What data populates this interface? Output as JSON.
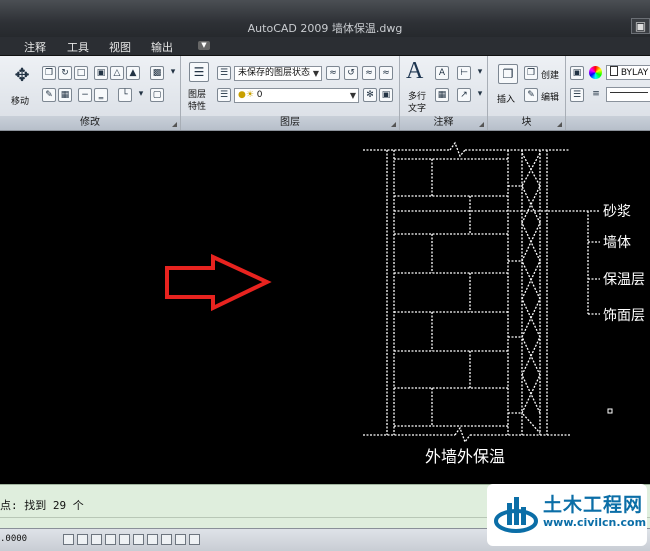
{
  "window": {
    "title": "AutoCAD 2009  墙体保温.dwg"
  },
  "tabs": [
    "注释",
    "工具",
    "视图",
    "输出"
  ],
  "ribbon": {
    "modify": {
      "move_label": "移动",
      "panel_label": "修改"
    },
    "layers": {
      "props_line1": "图层",
      "props_line2": "特性",
      "state_combo": "未保存的图层状态",
      "layer_combo": "0",
      "panel_label": "图层"
    },
    "annotation": {
      "mtext_line1": "多行",
      "mtext_line2": "文字",
      "panel_label": "注释"
    },
    "block": {
      "insert_label": "插入",
      "create_label": "创建",
      "edit_label": "编辑",
      "panel_label": "块"
    },
    "properties": {
      "color_value": "BYLAY"
    }
  },
  "drawing": {
    "labels": [
      "砂浆",
      "墙体",
      "保温层",
      "饰面层"
    ],
    "caption": "外墙外保温"
  },
  "command": {
    "line": "点: 找到 29 个"
  },
  "status": {
    "coords": ".0000"
  },
  "watermark": {
    "title": "土木工程网",
    "url": "www.civilcn.com"
  },
  "colors": {
    "arrow": "#e8231f",
    "drawing_lines": "#ffffff",
    "canvas": "#000000"
  }
}
